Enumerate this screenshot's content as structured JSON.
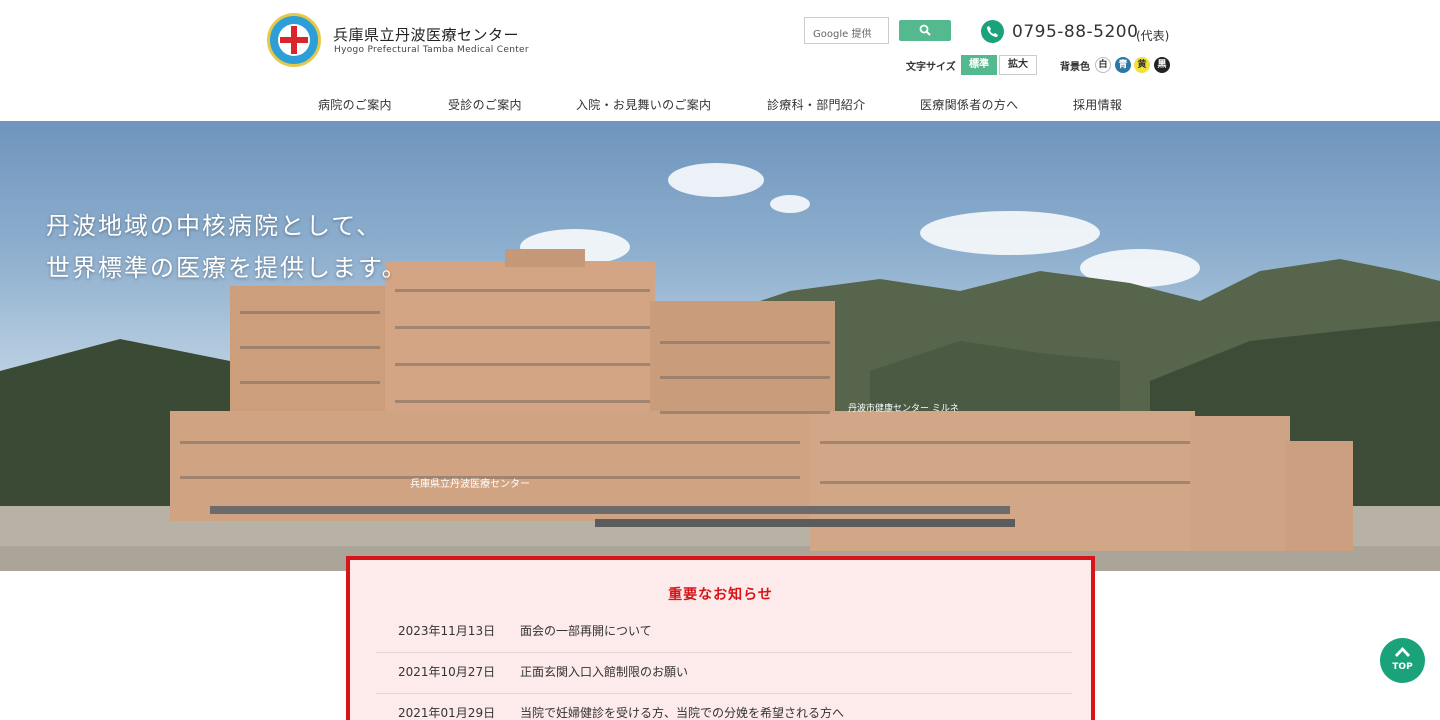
{
  "header": {
    "logo_icon": "hospital-emblem-icon",
    "title": "兵庫県立丹波医療センター",
    "subtitle": "Hyogo Prefectural Tamba Medical Center",
    "search": {
      "placeholder": "Google 提供",
      "button_icon": "search-icon"
    },
    "phone": {
      "icon": "phone-icon",
      "number": "0795-88-5200",
      "note": "(代表)"
    },
    "font_size": {
      "label": "文字サイズ",
      "standard": "標準",
      "large": "拡大"
    },
    "background_color": {
      "label": "背景色",
      "options": [
        "白",
        "青",
        "黄",
        "黒"
      ]
    }
  },
  "nav": {
    "items": [
      "病院のご案内",
      "受診のご案内",
      "入院・お見舞いのご案内",
      "診療科・部門紹介",
      "医療関係者の方へ",
      "採用情報"
    ]
  },
  "hero": {
    "line1": "丹波地域の中核病院として、",
    "line2": "世界標準の医療を提供します。",
    "building_sign1": "兵庫県立丹波医療センター",
    "building_sign2": "丹波市健康センター ミルネ"
  },
  "notice": {
    "title": "重要なお知らせ",
    "items": [
      {
        "date": "2023年11月13日",
        "text": "面会の一部再開について"
      },
      {
        "date": "2021年10月27日",
        "text": "正面玄関入口入館制限のお願い"
      },
      {
        "date": "2021年01月29日",
        "text": "当院で妊婦健診を受ける方、当院での分娩を希望される方へ"
      }
    ]
  },
  "top_button": {
    "label": "TOP",
    "icon": "chevron-up-icon"
  },
  "colors": {
    "accent_green": "#1aa37a",
    "notice_red": "#d71418",
    "notice_bg": "#fdeaea"
  }
}
